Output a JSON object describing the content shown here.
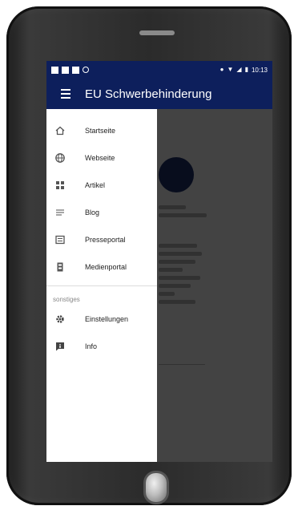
{
  "status_bar": {
    "time": "10:13",
    "icons_left": [
      "notification-icon",
      "notification-icon",
      "notification-icon",
      "sync-icon"
    ],
    "icons_right": [
      "location-icon",
      "wifi-icon",
      "signal-icon",
      "battery-icon"
    ]
  },
  "app_bar": {
    "title": "EU Schwerbehinderung",
    "menu_icon": "hamburger-menu-icon",
    "color": "#0d1f5c"
  },
  "drawer": {
    "items": [
      {
        "label": "Startseite",
        "icon": "home-icon"
      },
      {
        "label": "Webseite",
        "icon": "globe-icon"
      },
      {
        "label": "Artikel",
        "icon": "article-icon"
      },
      {
        "label": "Blog",
        "icon": "blog-icon"
      },
      {
        "label": "Presseportal",
        "icon": "press-icon"
      },
      {
        "label": "Medienportal",
        "icon": "media-icon"
      }
    ],
    "section_label": "sonstiges",
    "section_items": [
      {
        "label": "Einstellungen",
        "icon": "gear-icon"
      },
      {
        "label": "Info",
        "icon": "info-icon"
      }
    ]
  }
}
